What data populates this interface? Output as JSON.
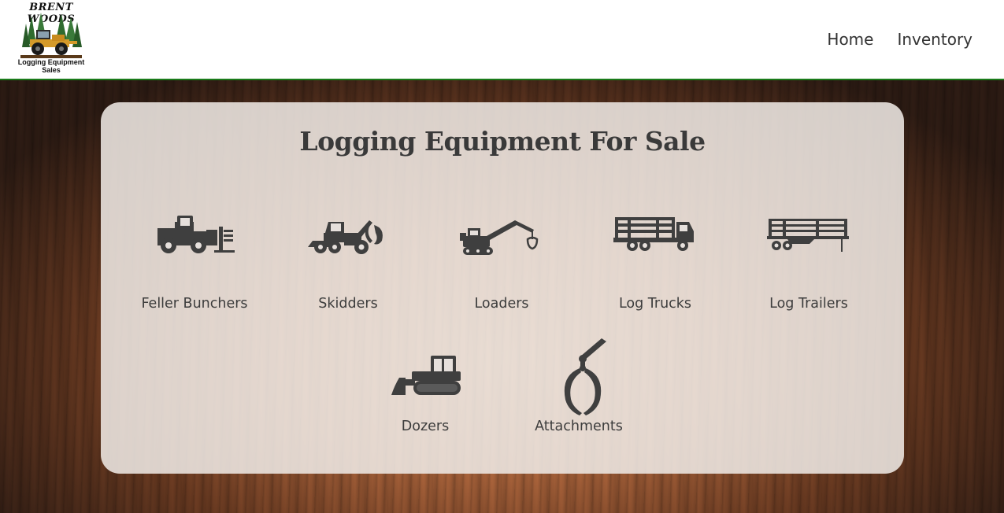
{
  "brand": {
    "top": "BRENT WOODS",
    "bottom_line1": "Logging Equipment",
    "bottom_line2": "Sales"
  },
  "nav": {
    "home": "Home",
    "inventory": "Inventory"
  },
  "main": {
    "title": "Logging Equipment For Sale",
    "categories": [
      {
        "label": "Feller Bunchers",
        "icon": "feller-buncher-icon"
      },
      {
        "label": "Skidders",
        "icon": "skidder-icon"
      },
      {
        "label": "Loaders",
        "icon": "loader-icon"
      },
      {
        "label": "Log Trucks",
        "icon": "log-truck-icon"
      },
      {
        "label": "Log Trailers",
        "icon": "log-trailer-icon"
      },
      {
        "label": "Dozers",
        "icon": "dozer-icon"
      },
      {
        "label": "Attachments",
        "icon": "grapple-attachment-icon"
      }
    ]
  },
  "colors": {
    "header_border": "#1a7a1a",
    "icon": "#3f3f3f",
    "panel": "#eee8e4"
  }
}
